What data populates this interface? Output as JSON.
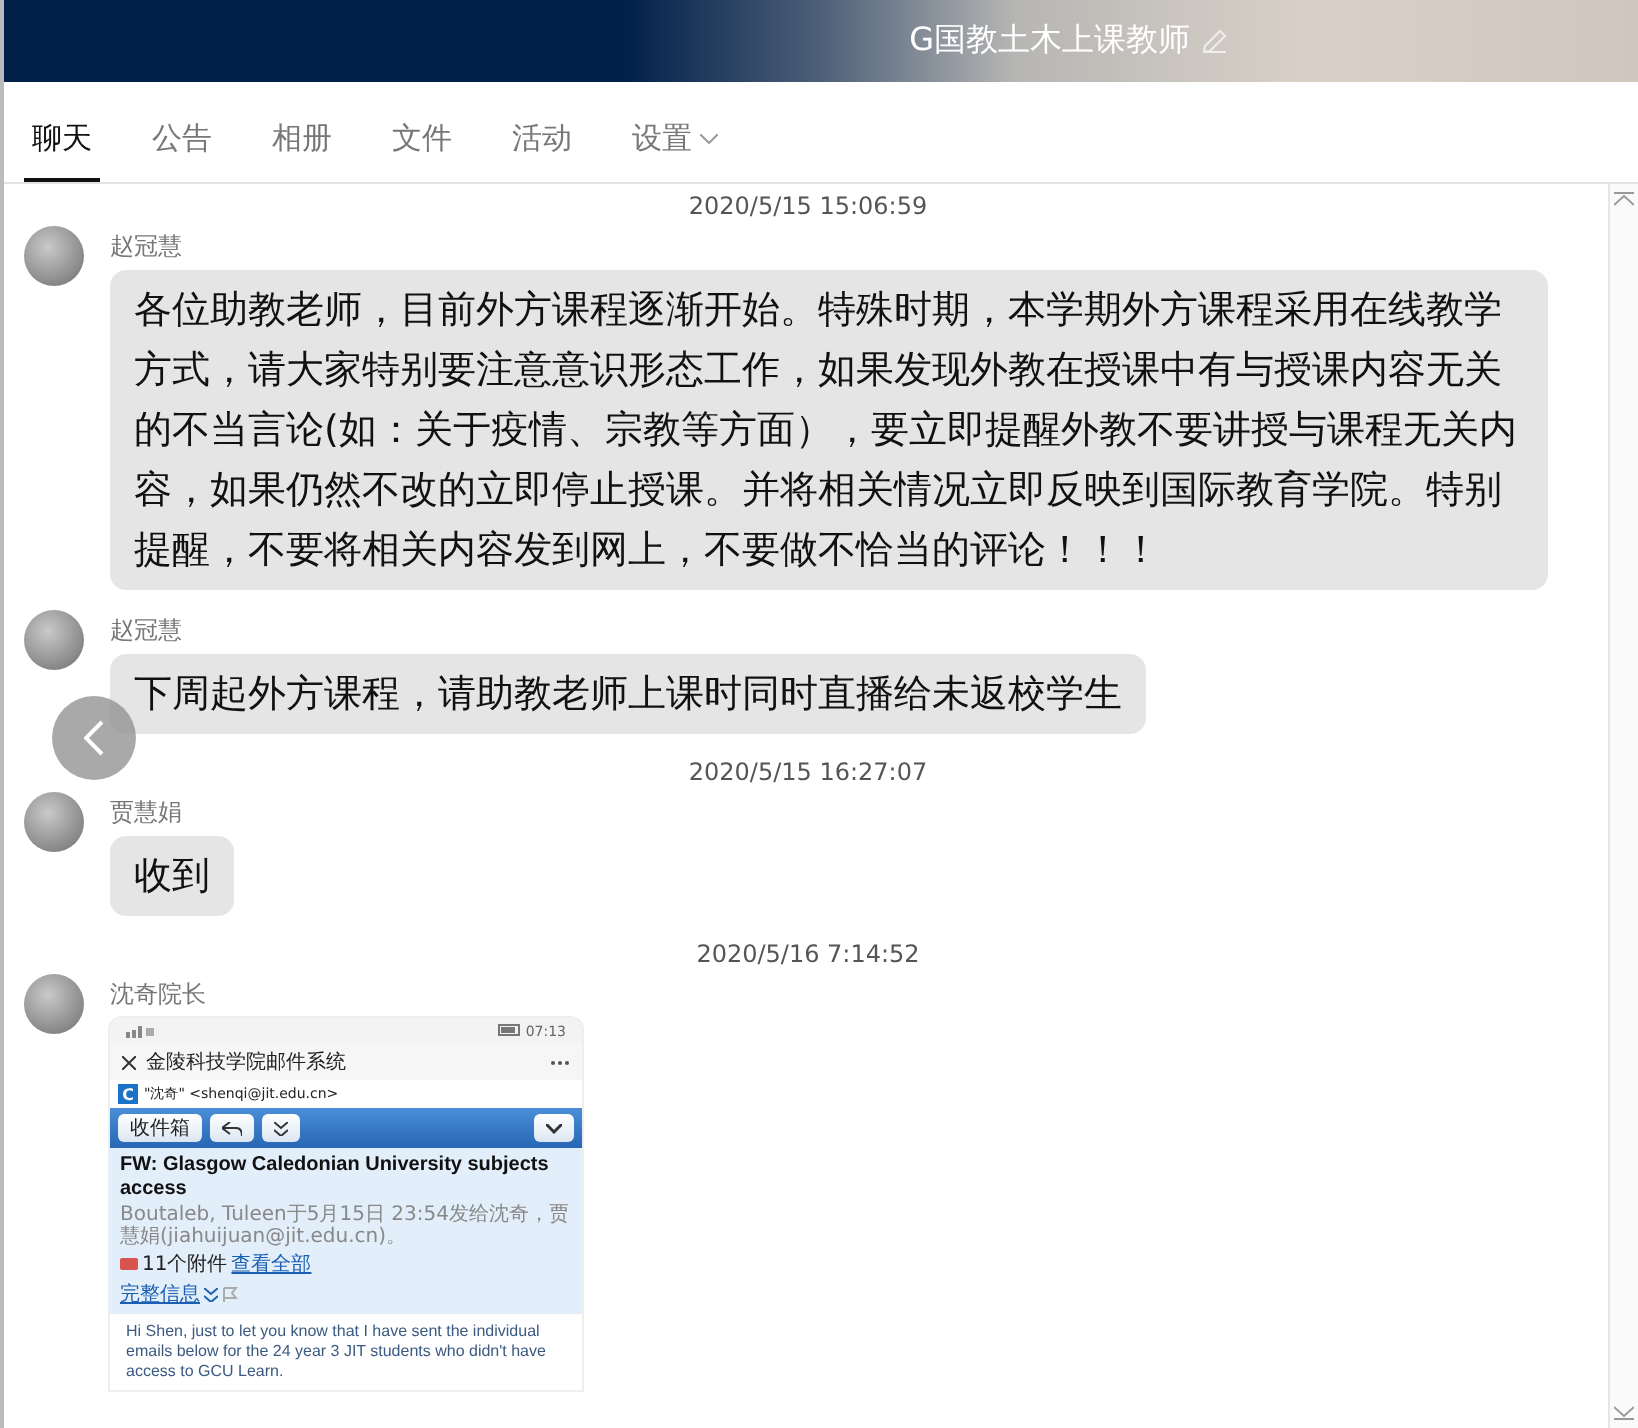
{
  "header": {
    "title": "G国教土木上课教师"
  },
  "tabs": [
    {
      "label": "聊天",
      "selected": true,
      "has_menu": false
    },
    {
      "label": "公告",
      "selected": false,
      "has_menu": false
    },
    {
      "label": "相册",
      "selected": false,
      "has_menu": false
    },
    {
      "label": "文件",
      "selected": false,
      "has_menu": false
    },
    {
      "label": "活动",
      "selected": false,
      "has_menu": false
    },
    {
      "label": "设置",
      "selected": false,
      "has_menu": true
    }
  ],
  "messages": [
    {
      "kind": "timestamp",
      "text": "2020/5/15 15:06:59"
    },
    {
      "kind": "text",
      "sender": "赵冠慧",
      "text": "各位助教老师，目前外方课程逐渐开始。特殊时期，本学期外方课程采用在线教学方式，请大家特别要注意意识形态工作，如果发现外教在授课中有与授课内容无关的不当言论(如：关于疫情、宗教等方面），要立即提醒外教不要讲授与课程无关内容，如果仍然不改的立即停止授课。并将相关情况立即反映到国际教育学院。特别提醒，不要将相关内容发到网上，不要做不恰当的评论！！！"
    },
    {
      "kind": "text",
      "sender": "赵冠慧",
      "text": "下周起外方课程，请助教老师上课时同时直播给未返校学生"
    },
    {
      "kind": "timestamp",
      "text": "2020/5/15 16:27:07"
    },
    {
      "kind": "text",
      "sender": "贾慧娟",
      "text": "收到"
    },
    {
      "kind": "timestamp",
      "text": "2020/5/16 7:14:52"
    },
    {
      "kind": "image",
      "sender": "沈奇院长",
      "screenshot": {
        "status_time": "07:13",
        "app_title": "金陵科技学院邮件系统",
        "logo_letter": "C",
        "from": "\"沈奇\" <shenqi@jit.edu.cn>",
        "toolbar_button": "收件箱",
        "subject": "FW: Glasgow Caledonian University subjects access",
        "meta": "Boutaleb, Tuleen于5月15日 23:54发给沈奇，贾慧娟(jiahuijuan@jit.edu.cn)。",
        "attachments": "11个附件",
        "attachments_link": "查看全部",
        "details_link": "完整信息",
        "body": "Hi Shen, just to let you know that I have sent the individual emails below for the 24 year 3 JIT students who didn't have access to GCU Learn."
      }
    }
  ]
}
